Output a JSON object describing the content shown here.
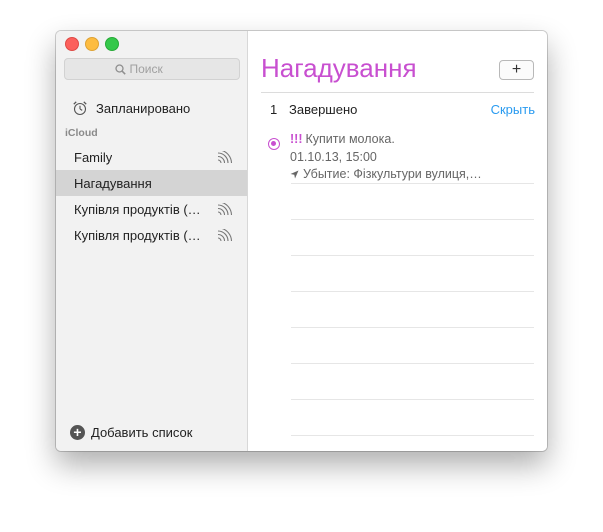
{
  "sidebar": {
    "search_placeholder": "Поиск",
    "scheduled_label": "Запланировано",
    "section_label": "iCloud",
    "lists": [
      {
        "label": "Family",
        "shared": true,
        "selected": false
      },
      {
        "label": "Нагадування",
        "shared": false,
        "selected": true
      },
      {
        "label": "Купівля продуктів (…",
        "shared": true,
        "selected": false
      },
      {
        "label": "Купівля продуктів (…",
        "shared": true,
        "selected": false
      }
    ],
    "add_list_label": "Добавить список"
  },
  "main": {
    "title": "Нагадування",
    "add_button_label": "+",
    "completed_count": "1",
    "completed_label": "Завершено",
    "hide_label": "Скрыть",
    "reminders": [
      {
        "priority": "!!!",
        "title": "Купити молока.",
        "date": "01.10.13, 15:00",
        "location": "Убытие: Фізкультури вулиця,…"
      }
    ]
  },
  "icons": {
    "search": "search-icon",
    "alarm": "alarm-clock-icon",
    "share": "shared-list-icon",
    "location": "location-arrow-icon"
  },
  "colors": {
    "accent": "#c84fd0",
    "link": "#2a9bf0",
    "close": "#fc605c",
    "minimize": "#fdbc40",
    "maximize": "#34c84a"
  }
}
